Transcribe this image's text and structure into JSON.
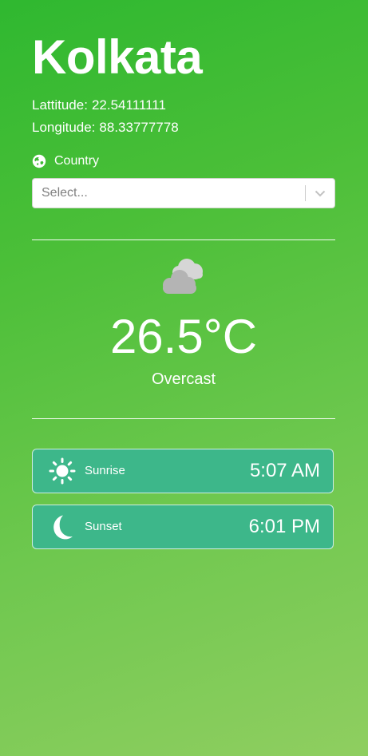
{
  "location": {
    "city": "Kolkata",
    "latitude_label": "Lattitude:",
    "latitude_value": "22.54111111",
    "longitude_label": "Longitude:",
    "longitude_value": "88.33777778"
  },
  "country_selector": {
    "label": "Country",
    "icon": "globe-icon",
    "placeholder": "Select..."
  },
  "weather": {
    "icon": "cloud-icon",
    "temperature": "26.5°C",
    "condition": "Overcast"
  },
  "sun_times": [
    {
      "icon": "sun-icon",
      "label": "Sunrise",
      "time": "5:07 AM"
    },
    {
      "icon": "moon-icon",
      "label": "Sunset",
      "time": "6:01 PM"
    }
  ],
  "colors": {
    "background_start": "#2fb830",
    "background_end": "#8fce60",
    "card": "#3db78a",
    "text": "#ffffff"
  }
}
